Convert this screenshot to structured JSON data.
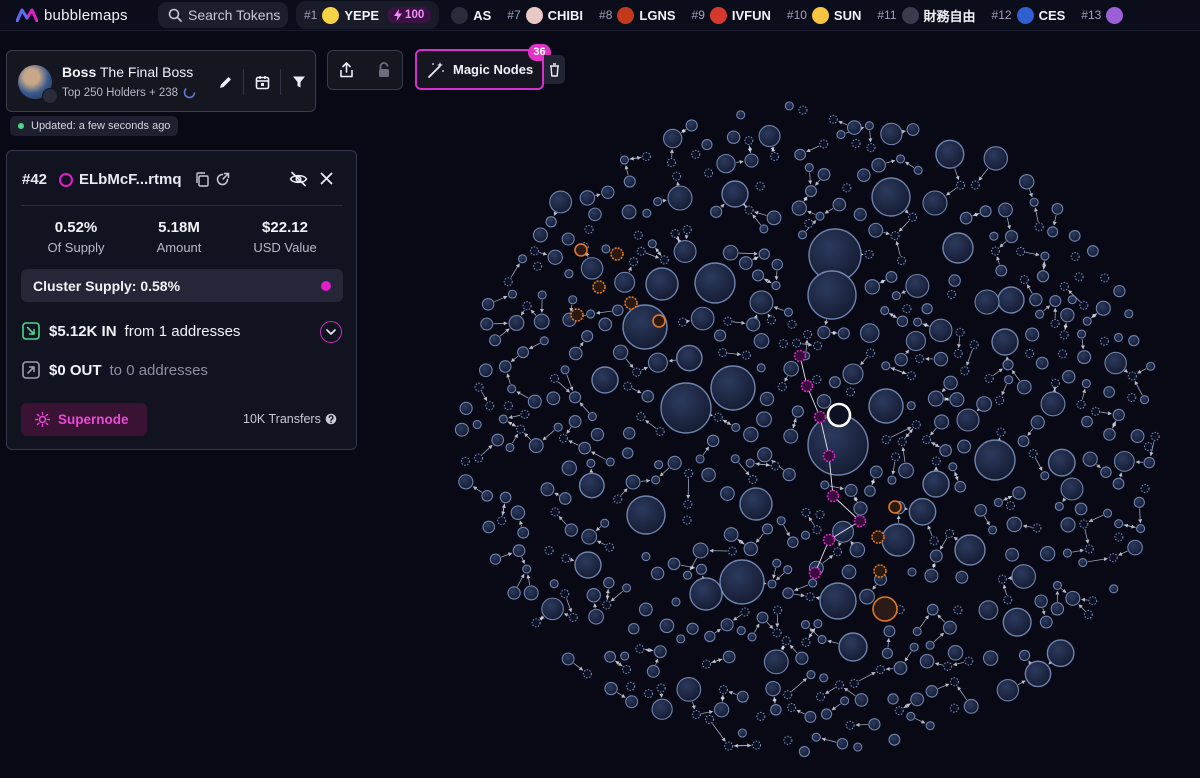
{
  "app": {
    "name": "bubblemaps",
    "accent": "#e01ec8",
    "background": "#080914"
  },
  "search": {
    "label": "Search Tokens"
  },
  "trending": [
    {
      "rank": "#1",
      "symbol": "YEPE",
      "avatar_color": "#f7d246",
      "boost": "100"
    },
    {
      "rank": "",
      "symbol": "AS",
      "avatar_color": "#2a2c3c"
    },
    {
      "rank": "#7",
      "symbol": "CHIBI",
      "avatar_color": "#e8c9c5"
    },
    {
      "rank": "#8",
      "symbol": "LGNS",
      "avatar_color": "#c23a1c"
    },
    {
      "rank": "#9",
      "symbol": "IVFUN",
      "avatar_color": "#d4382f"
    },
    {
      "rank": "#10",
      "symbol": "SUN",
      "avatar_color": "#f5c542"
    },
    {
      "rank": "#11",
      "symbol": "財務自由",
      "avatar_color": "#3a3c4c"
    },
    {
      "rank": "#12",
      "symbol": "CES",
      "avatar_color": "#2f5fd0"
    },
    {
      "rank": "#13",
      "symbol": "",
      "avatar_color": "#9b5fd8"
    }
  ],
  "map_card": {
    "owner": "Boss",
    "title": "The Final Boss",
    "subtitle": "Top 250 Holders + 238",
    "updated": "Updated: a few seconds ago"
  },
  "magic_nodes": {
    "label": "Magic Nodes",
    "count": "36"
  },
  "wallet": {
    "rank": "#42",
    "address": "ELbMcF...rtmq",
    "supply_pct": "0.52%",
    "supply_label": "Of Supply",
    "amount": "5.18M",
    "amount_label": "Amount",
    "usd": "$22.12",
    "usd_label": "USD Value",
    "cluster_supply": "Cluster Supply: 0.58%",
    "in_value": "$5.12K IN",
    "in_from": "from 1 addresses",
    "out_value": "$0 OUT",
    "out_to": "to 0 addresses",
    "supernode_label": "Supernode",
    "transfers": "10K Transfers"
  },
  "colors": {
    "bubble_fill": "#1f2a46",
    "bubble_stroke": "#7f96c4",
    "cluster_magenta": "#d22cc2",
    "cluster_orange": "#e0782a",
    "selected": "#ffffff",
    "positive": "#4ad88a"
  }
}
